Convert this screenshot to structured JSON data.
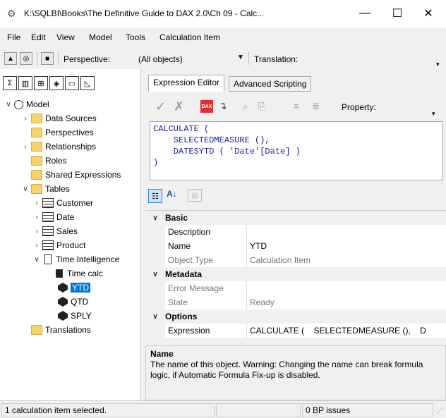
{
  "window": {
    "title": "K:\\SQLBI\\Books\\The Definitive Guide to DAX 2.0\\Ch 09 - Calc...",
    "minimize": "—",
    "maximize": "☐",
    "close": "✕"
  },
  "menu": [
    "File",
    "Edit",
    "View",
    "Model",
    "Tools",
    "Calculation Item"
  ],
  "toolbar": {
    "perspective_label": "Perspective:",
    "perspective_value": "(All objects)",
    "translation_label": "Translation:"
  },
  "tree": {
    "model": "Model",
    "data_sources": "Data Sources",
    "perspectives": "Perspectives",
    "relationships": "Relationships",
    "roles": "Roles",
    "shared_expressions": "Shared Expressions",
    "tables": "Tables",
    "customer": "Customer",
    "date": "Date",
    "sales": "Sales",
    "product": "Product",
    "time_intelligence": "Time Intelligence",
    "time_calc": "Time calc",
    "ytd": "YTD",
    "qtd": "QTD",
    "sply": "SPLY",
    "translations": "Translations"
  },
  "tabs": {
    "expression_editor": "Expression Editor",
    "advanced_scripting": "Advanced Scripting"
  },
  "editor": {
    "property_label": "Property:",
    "line1": "CALCULATE (",
    "line2": "    SELECTEDMEASURE (),",
    "line3": "    DATESYTD ( 'Date'[Date] )",
    "line4": ")"
  },
  "properties": {
    "basic": "Basic",
    "description": "Description",
    "name_label": "Name",
    "name_value": "YTD",
    "object_type_label": "Object Type",
    "object_type_value": "Calculation Item",
    "metadata": "Metadata",
    "error_message": "Error Message",
    "state_label": "State",
    "state_value": "Ready",
    "options": "Options",
    "expression_label": "Expression",
    "expression_value": "CALCULATE (    SELECTEDMEASURE (),    D"
  },
  "description_box": {
    "title": "Name",
    "text": "The name of this object. Warning: Changing the name can break formula logic, if Automatic Formula Fix-up is disabled."
  },
  "status": {
    "left": "1 calculation item selected.",
    "issues": "0 BP issues"
  }
}
